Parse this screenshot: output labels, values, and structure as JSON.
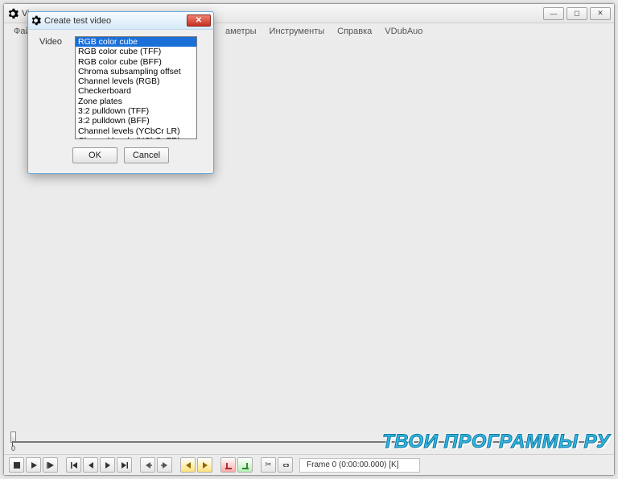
{
  "main": {
    "title_prefix": "Vi",
    "window_controls": {
      "min": "—",
      "max": "◻",
      "close": "✕"
    }
  },
  "menubar": {
    "items": [
      "Файл",
      "аметры",
      "Инструменты",
      "Справка",
      "VDubAuo"
    ]
  },
  "seek": {
    "start": "0",
    "end": ""
  },
  "framebox": "Frame 0 (0:00:00.000) [K]",
  "dialog": {
    "title": "Create test video",
    "label": "Video",
    "options": [
      "RGB color cube",
      "RGB color cube (TFF)",
      "RGB color cube (BFF)",
      "Chroma subsampling offset",
      "Channel levels (RGB)",
      "Checkerboard",
      "Zone plates",
      "3:2 pulldown (TFF)",
      "3:2 pulldown (BFF)",
      "Channel levels (YCbCr LR)",
      "Channel levels (YCbCr FR)"
    ],
    "selected_index": 0,
    "ok": "OK",
    "cancel": "Cancel",
    "close_glyph": "✕"
  },
  "watermark": "ТВОИ ПРОГРАММЫ РУ"
}
